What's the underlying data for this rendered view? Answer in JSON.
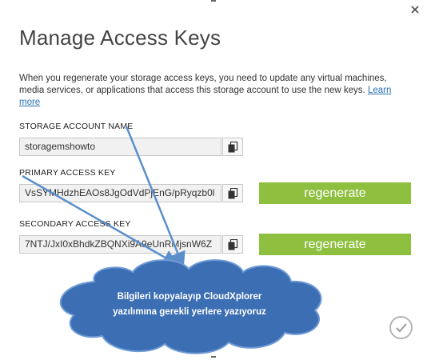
{
  "dialog": {
    "title": "Manage Access Keys",
    "description": "When you regenerate your storage access keys, you need to update any virtual machines, media services, or applications that access this storage account to use the new keys.",
    "learn_more": "Learn more"
  },
  "storage_account": {
    "label": "STORAGE ACCOUNT NAME",
    "value": "storagemshowto"
  },
  "primary_key": {
    "label": "PRIMARY ACCESS KEY",
    "value": "VsSYMHdzhEAOs8JgOdVdPjEnG/pRyqzb0l",
    "regenerate_label": "regenerate"
  },
  "secondary_key": {
    "label": "SECONDARY ACCESS KEY",
    "value": "7NTJ/JxI0xBhdkZBQNXi9A9eUnRMjsnW6Z",
    "regenerate_label": "regenerate"
  },
  "annotation": {
    "line1": "Bilgileri kopyalayıp CloudXplorer",
    "line2": "yazılımına gerekli yerlere yazıyoruz"
  },
  "icons": {
    "close": "close-icon",
    "copy": "copy-icon",
    "confirm": "checkmark-icon"
  },
  "colors": {
    "regenerate_button": "#8ebf3f",
    "annotation_cloud": "#3b6eb3",
    "annotation_arrow": "#5b8fcc"
  }
}
